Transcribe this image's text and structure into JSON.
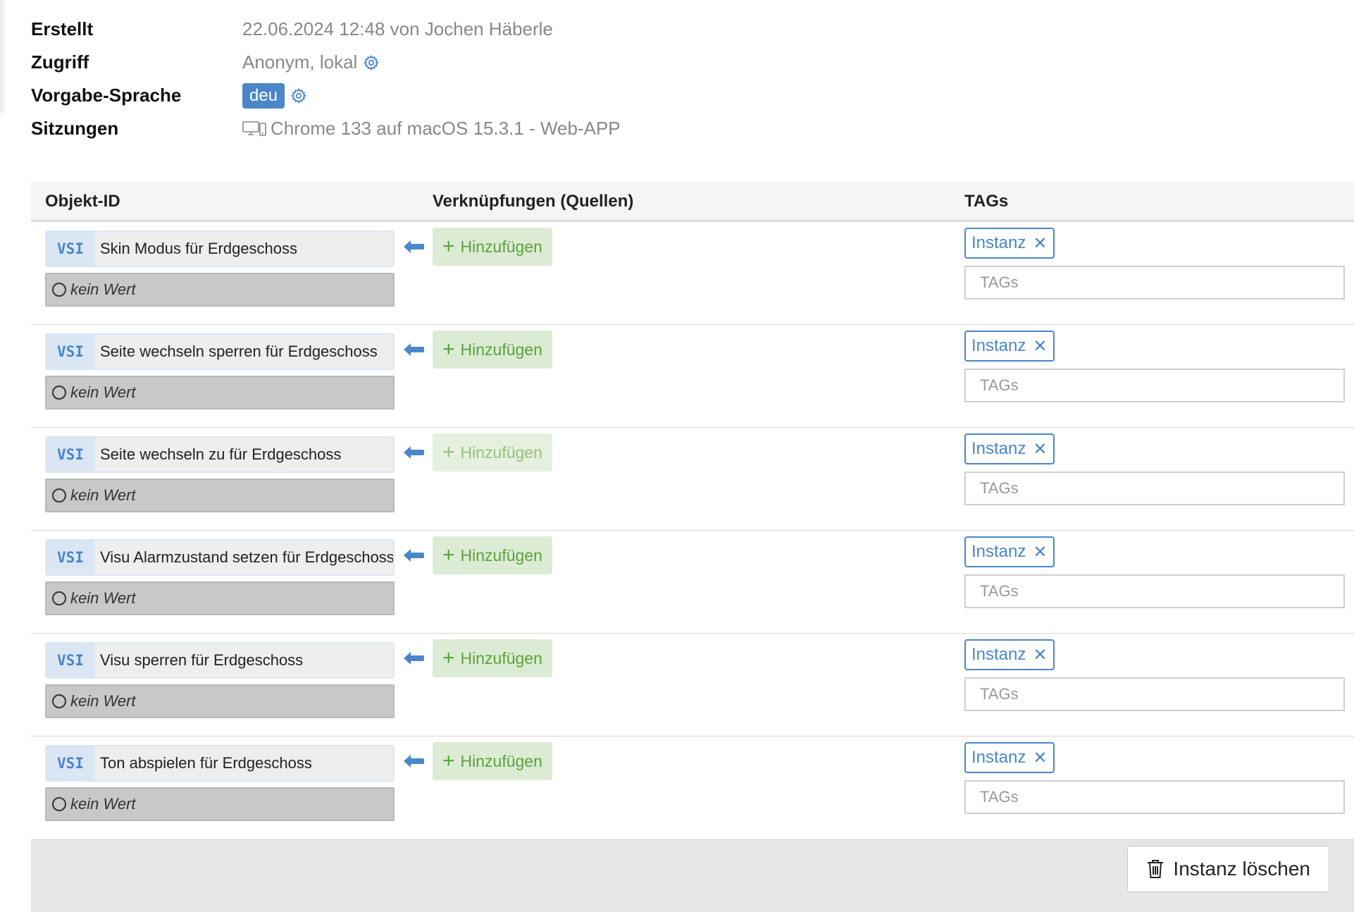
{
  "info": {
    "created_label": "Erstellt",
    "created_value": "22.06.2024 12:48 von Jochen Häberle",
    "access_label": "Zugriff",
    "access_value": "Anonym, lokal",
    "language_label": "Vorgabe-Sprache",
    "language_value": "deu",
    "sessions_label": "Sitzungen",
    "sessions_value": "Chrome 133 auf macOS 15.3.1 - Web-APP"
  },
  "table": {
    "headers": {
      "object_id": "Objekt-ID",
      "links": "Verknüpfungen (Quellen)",
      "tags": "TAGs"
    },
    "rows": [
      {
        "type": "VSI",
        "name": "Skin Modus für Erdgeschoss",
        "value": "kein Wert",
        "add_label": "Hinzufügen",
        "tag": "Instanz",
        "tag_placeholder": "TAGs"
      },
      {
        "type": "VSI",
        "name": "Seite wechseln sperren für Erdgeschoss",
        "value": "kein Wert",
        "add_label": "Hinzufügen",
        "tag": "Instanz",
        "tag_placeholder": "TAGs"
      },
      {
        "type": "VSI",
        "name": "Seite wechseln zu für Erdgeschoss",
        "value": "kein Wert",
        "add_label": "Hinzufügen",
        "tag": "Instanz",
        "tag_placeholder": "TAGs"
      },
      {
        "type": "VSI",
        "name": "Visu Alarmzustand setzen für Erdgeschoss",
        "value": "kein Wert",
        "add_label": "Hinzufügen",
        "tag": "Instanz",
        "tag_placeholder": "TAGs"
      },
      {
        "type": "VSI",
        "name": "Visu sperren für Erdgeschoss",
        "value": "kein Wert",
        "add_label": "Hinzufügen",
        "tag": "Instanz",
        "tag_placeholder": "TAGs"
      },
      {
        "type": "VSI",
        "name": "Ton abspielen für Erdgeschoss",
        "value": "kein Wert",
        "add_label": "Hinzufügen",
        "tag": "Instanz",
        "tag_placeholder": "TAGs"
      }
    ]
  },
  "footer": {
    "delete_label": "Instanz löschen"
  },
  "icons": {
    "gear": "gear-icon",
    "device": "desktop-mobile-icon",
    "arrow": "arrow-left-icon",
    "plus": "plus-icon",
    "remove": "close-icon",
    "trash": "trash-icon",
    "empty_value": "circle-icon"
  },
  "colors": {
    "accent_blue": "#4a86c8",
    "add_green": "#5aa33a",
    "add_bg": "#dcebd4",
    "value_bg": "#c8c8c8"
  }
}
